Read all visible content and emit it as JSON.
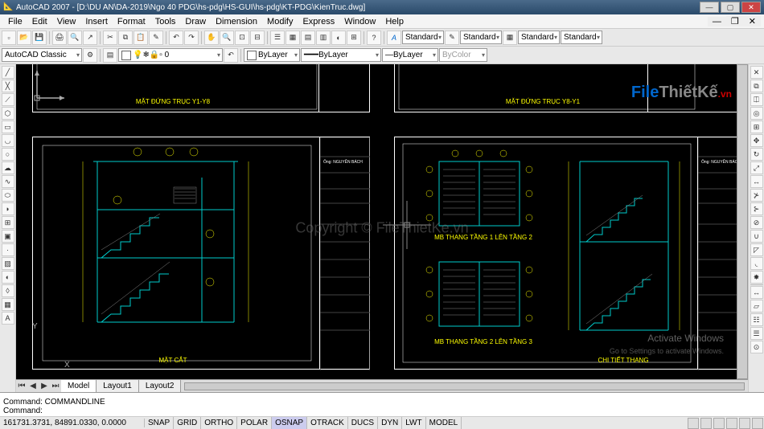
{
  "title": "AutoCAD 2007 - [D:\\DU AN\\DA-2019\\Ngo 40 PDG\\hs-pdg\\HS-GUI\\hs-pdg\\KT-PDG\\KienTruc.dwg]",
  "menu": [
    "File",
    "Edit",
    "View",
    "Insert",
    "Format",
    "Tools",
    "Draw",
    "Dimension",
    "Modify",
    "Express",
    "Window",
    "Help"
  ],
  "workspace": "AutoCAD Classic",
  "tb2": {
    "layer_combo": "",
    "std1": "Standard",
    "std2": "Standard",
    "std3": "Standard",
    "std4": "Standard",
    "bylayer1": "ByLayer",
    "bylayer2": "ByLayer",
    "bylayer3": "ByLayer",
    "bycolor": "ByColor"
  },
  "drawing": {
    "sheet_top1_title": "MẶT ĐỨNG TRỤC Y1-Y8",
    "sheet_top2_title": "MẶT ĐỨNG TRỤC Y8-Y1",
    "sheet_bl_title": "MẶT CẮT",
    "sheet_bm_t1": "MB THANG TẦNG 1 LÊN TẦNG 2",
    "sheet_bm_t2": "MB THANG TẦNG 2 LÊN TẦNG 3",
    "sheet_br_title": "CHI TIẾT THANG",
    "titleblock_owner": "Ông: NGUYỄN BÁCH"
  },
  "axes": {
    "x": "X",
    "y": "Y"
  },
  "tabs": {
    "model": "Model",
    "l1": "Layout1",
    "l2": "Layout2"
  },
  "cmd": {
    "line1": "Command: COMMANDLINE",
    "prompt": "Command:",
    "input": ""
  },
  "status": {
    "coords": "161731.3731, 84891.0330, 0.0000",
    "buttons": [
      "SNAP",
      "GRID",
      "ORTHO",
      "POLAR",
      "OSNAP",
      "OTRACK",
      "DUCS",
      "DYN",
      "LWT",
      "MODEL"
    ]
  },
  "watermark": {
    "center": "Copyright © FileThietKe.vn",
    "logo_file": "File",
    "logo_tk": "ThiếtKế",
    "logo_vn": ".vn",
    "win1": "Activate Windows",
    "win2": "Go to Settings to activate Windows."
  }
}
